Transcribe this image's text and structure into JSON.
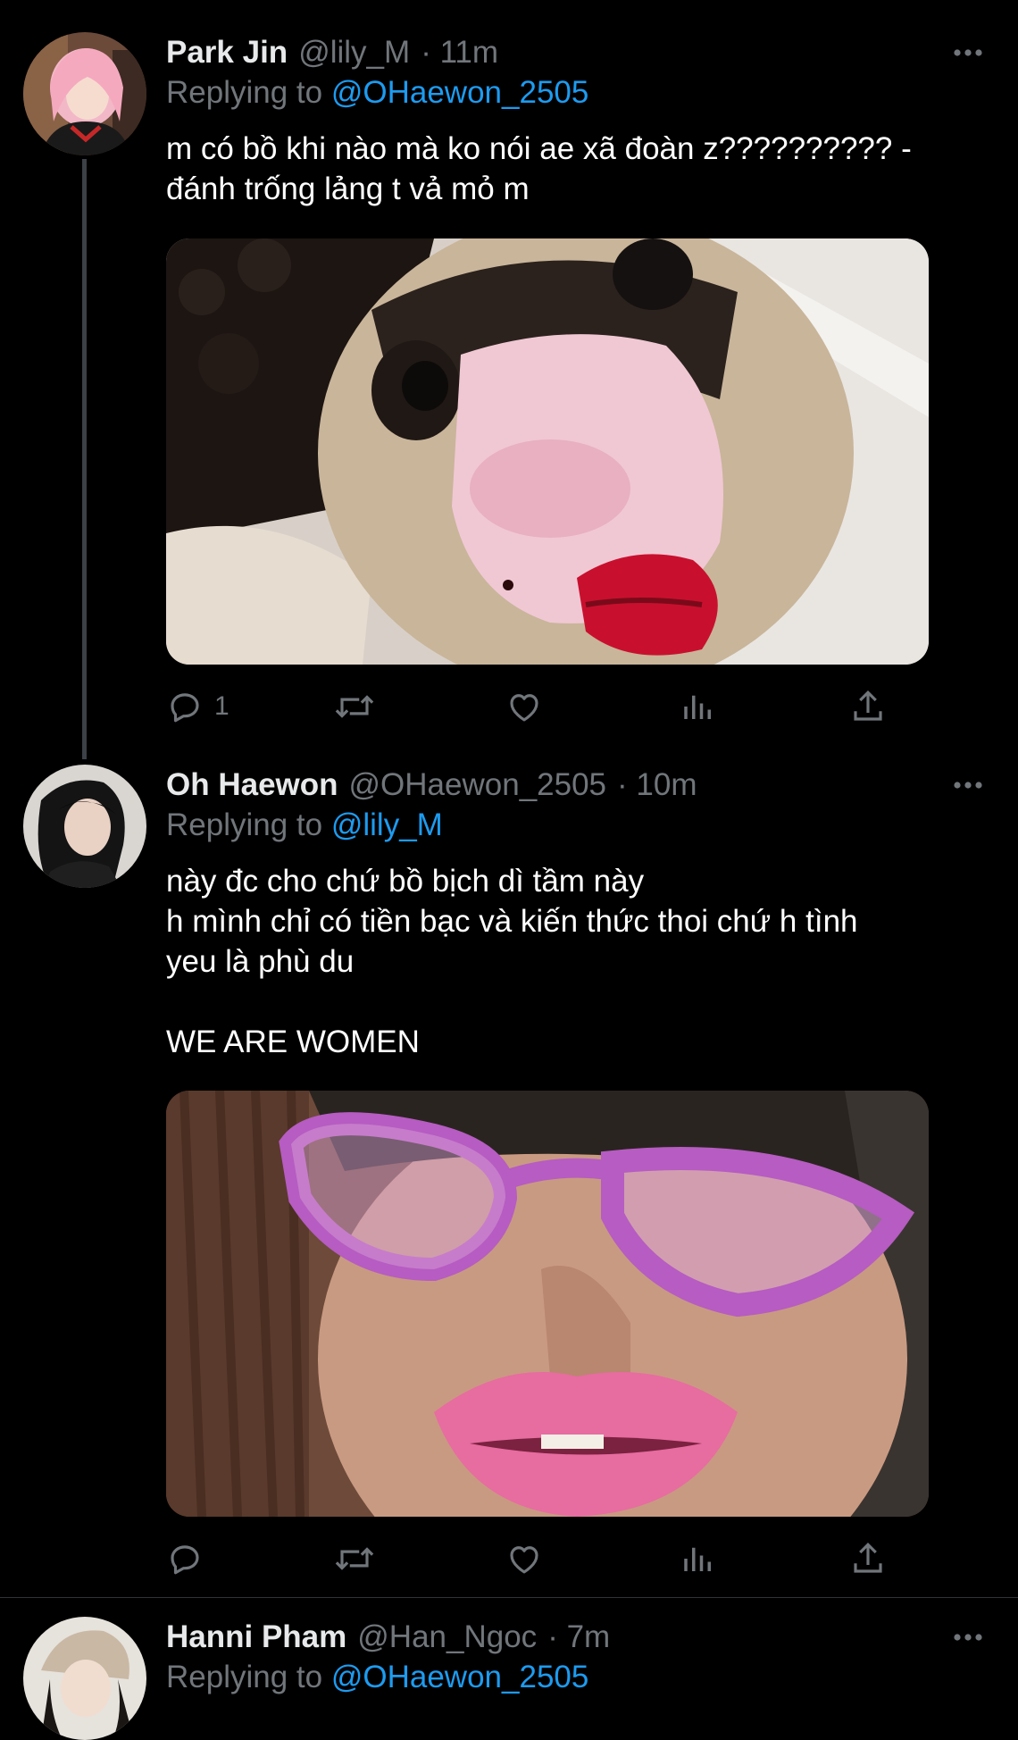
{
  "tweets": [
    {
      "display_name": "Park Jin",
      "handle": "@lily_M",
      "time": "· 11m",
      "replying_label": "Replying to",
      "replying_to": "@OHaewon_2505",
      "text_lines": [
        "m có bồ khi nào mà ko nói ae xã đoàn z?????????? -",
        "đánh trống lảng t vả mỏ m"
      ],
      "actions": {
        "reply_count": "1"
      }
    },
    {
      "display_name": "Oh Haewon",
      "handle": "@OHaewon_2505",
      "time": "· 10m",
      "replying_label": "Replying to",
      "replying_to": "@lily_M",
      "text_lines": [
        "này đc cho chứ bồ bịch dì tầm này",
        "h mình chỉ có tiền bạc và kiến thức thoi chứ h tình",
        "yeu là phù du",
        "",
        "WE ARE WOMEN"
      ],
      "actions": {
        "reply_count": ""
      }
    },
    {
      "display_name": "Hanni Pham",
      "handle": "@Han_Ngoc",
      "time": "· 7m",
      "replying_label": "Replying to",
      "replying_to": "@OHaewon_2505"
    }
  ],
  "icons": {
    "more": "more-horizontal-icon",
    "reply": "reply-icon",
    "retweet": "retweet-icon",
    "like": "heart-icon",
    "analytics": "analytics-icon",
    "share": "share-icon"
  },
  "colors": {
    "background": "#000000",
    "mention": "#1d9bf0",
    "secondary_text": "#71767b",
    "primary_text": "#ffffff"
  }
}
